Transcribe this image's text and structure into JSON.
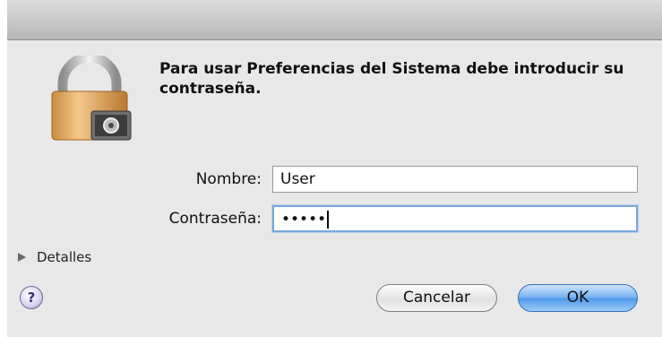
{
  "dialog": {
    "message": "Para usar Preferencias del Sistema debe introducir su contraseña."
  },
  "icons": {
    "lock": "padlock-with-system-preferences-icon",
    "disclosure": "disclosure-triangle-icon",
    "help": "help-icon"
  },
  "form": {
    "name_label": "Nombre:",
    "name_value": "User",
    "password_label": "Contraseña:",
    "password_value": "•••••"
  },
  "details_label": "Detalles",
  "help_label": "?",
  "buttons": {
    "cancel": "Cancelar",
    "ok": "OK"
  },
  "colors": {
    "default_button": "#5a9ee9",
    "focus_ring": "#7aa7dc"
  }
}
